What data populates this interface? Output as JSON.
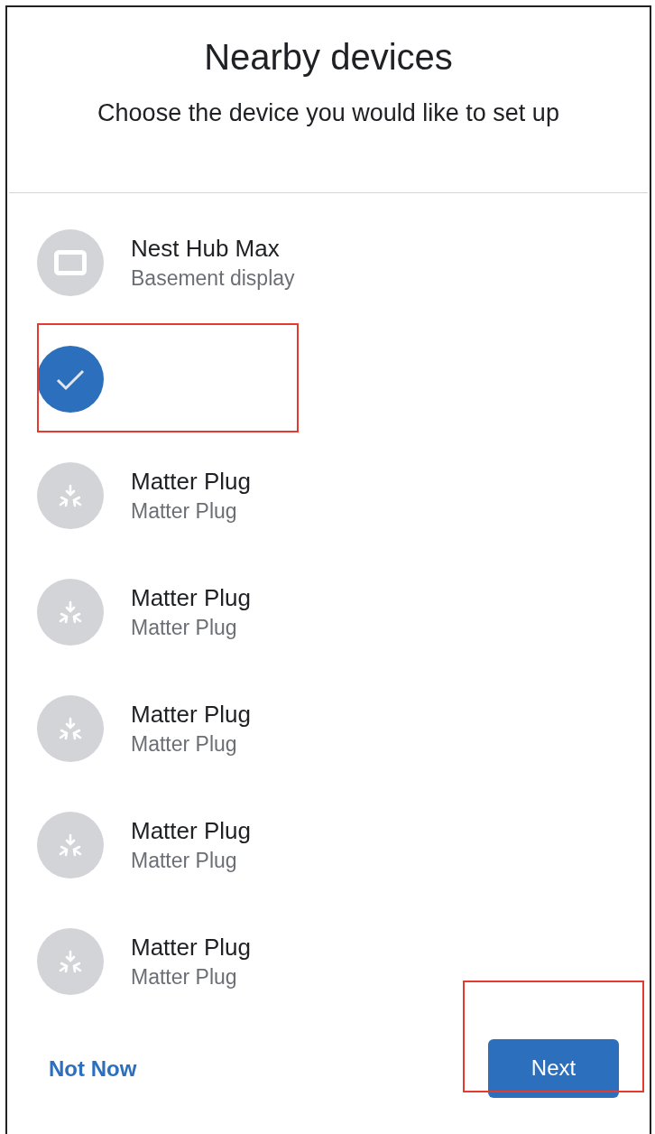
{
  "header": {
    "title": "Nearby devices",
    "subtitle": "Choose the device you would like to set up"
  },
  "devices": [
    {
      "kind": "display",
      "name": "Nest Hub Max",
      "subtitle": "Basement display",
      "selected": false,
      "highlighted": false
    },
    {
      "selected": true,
      "highlighted": true
    },
    {
      "kind": "matter",
      "name": "Matter Plug",
      "subtitle": "Matter Plug",
      "selected": false,
      "highlighted": false
    },
    {
      "kind": "matter",
      "name": "Matter Plug",
      "subtitle": "Matter Plug",
      "selected": false,
      "highlighted": false
    },
    {
      "kind": "matter",
      "name": "Matter Plug",
      "subtitle": "Matter Plug",
      "selected": false,
      "highlighted": false
    },
    {
      "kind": "matter",
      "name": "Matter Plug",
      "subtitle": "Matter Plug",
      "selected": false,
      "highlighted": false
    },
    {
      "kind": "matter",
      "name": "Matter Plug",
      "subtitle": "Matter Plug",
      "selected": false,
      "highlighted": false
    }
  ],
  "footer": {
    "secondary": {
      "label": "Not Now"
    },
    "primary": {
      "label": "Next",
      "highlighted": true
    }
  }
}
